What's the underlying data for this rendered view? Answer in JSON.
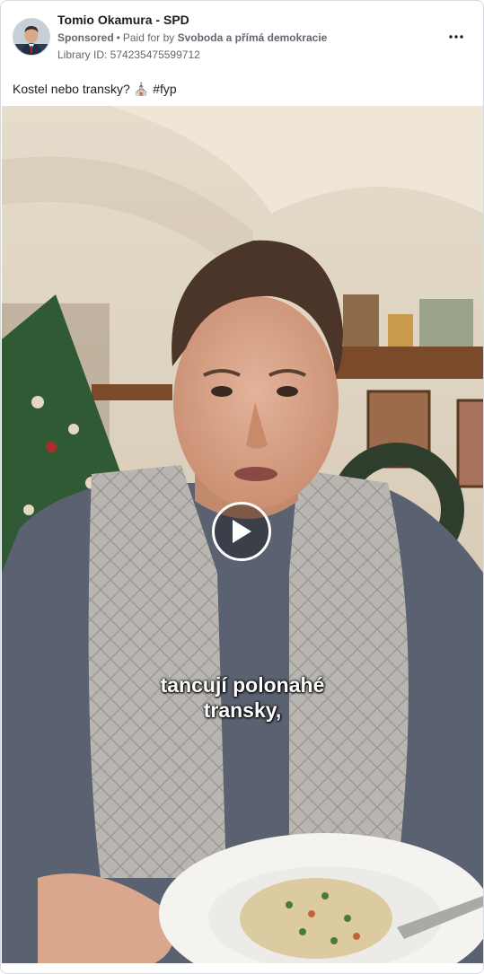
{
  "header": {
    "page_name": "Tomio Okamura - SPD",
    "sponsored_label": "Sponsored",
    "separator": "•",
    "paid_for_prefix": "Paid for by",
    "payer_name": "Svoboda a přímá demokracie",
    "library_id": "Library ID: 574235475599712",
    "avatar_icon": "profile-avatar",
    "more_icon": "more-options-icon"
  },
  "post": {
    "caption_text": "Kostel nebo transky?",
    "caption_emoji": "⛪",
    "caption_hashtag": "#fyp"
  },
  "video": {
    "subtitle_line1": "tancují polonahé",
    "subtitle_line2": "transky,",
    "play_icon": "play-icon"
  },
  "colors": {
    "text_primary": "#1c1e21",
    "text_secondary": "#65676b",
    "border": "#d6d9dd",
    "play_button": "#ffffff"
  }
}
